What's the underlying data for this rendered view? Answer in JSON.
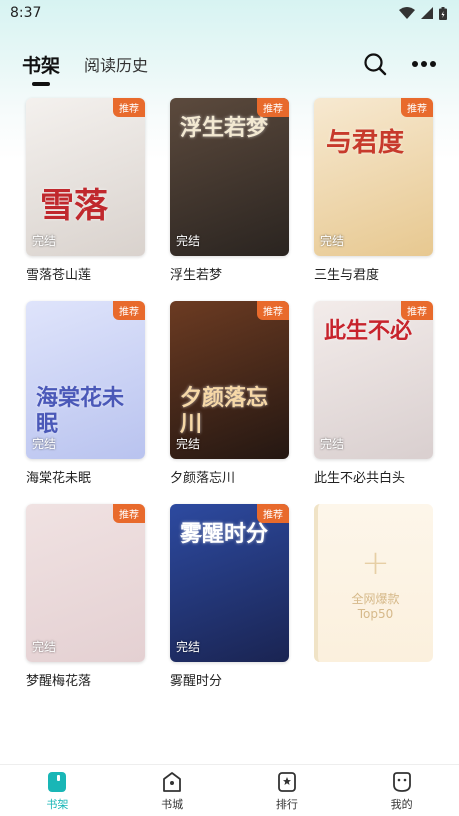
{
  "status_bar": {
    "time": "8:37"
  },
  "header": {
    "tabs": [
      {
        "label": "书架"
      },
      {
        "label": "阅读历史"
      }
    ]
  },
  "books": [
    {
      "title": "雪落苍山莲",
      "badge": "推荐",
      "status": "完结",
      "cover_text": "雪落",
      "cover_colors": [
        "#f4f1ee",
        "#d9d2cd"
      ],
      "accent": "#c0282d"
    },
    {
      "title": "浮生若梦",
      "badge": "推荐",
      "status": "完结",
      "cover_text": "浮生若梦",
      "cover_colors": [
        "#5c4a3d",
        "#2a2420"
      ],
      "accent": "#f3e9d2"
    },
    {
      "title": "三生与君度",
      "badge": "推荐",
      "status": "完结",
      "cover_text": "与君度",
      "cover_colors": [
        "#f7e9d1",
        "#e7c890"
      ],
      "accent": "#c73a2c"
    },
    {
      "title": "海棠花未眠",
      "badge": "推荐",
      "status": "完结",
      "cover_text": "海棠花未眠",
      "cover_colors": [
        "#dfe4fb",
        "#b9c3ef"
      ],
      "accent": "#4a58b8"
    },
    {
      "title": "夕颜落忘川",
      "badge": "推荐",
      "status": "完结",
      "cover_text": "夕颜落忘川",
      "cover_colors": [
        "#6c3b22",
        "#241712"
      ],
      "accent": "#f6d8a7"
    },
    {
      "title": "此生不必共白头",
      "badge": "推荐",
      "status": "完结",
      "cover_text": "此生不必",
      "cover_colors": [
        "#f3ecea",
        "#d9cfcf"
      ],
      "accent": "#c7232c"
    },
    {
      "title": "梦醒梅花落",
      "badge": "推荐",
      "status": "完结",
      "cover_text": "",
      "cover_colors": [
        "#f0e2e2",
        "#e4d0d2"
      ],
      "accent": "#c8a0a4"
    },
    {
      "title": "雾醒时分",
      "badge": "推荐",
      "status": "完结",
      "cover_text": "雾醒时分",
      "cover_colors": [
        "#2d4aa0",
        "#1a2452"
      ],
      "accent": "#ffffff"
    }
  ],
  "placeholder": {
    "line1": "全网爆款",
    "line2": "Top50"
  },
  "bottom_nav": [
    {
      "label": "书架",
      "icon": "bookshelf-icon"
    },
    {
      "label": "书城",
      "icon": "store-icon"
    },
    {
      "label": "排行",
      "icon": "ranking-icon"
    },
    {
      "label": "我的",
      "icon": "profile-icon"
    }
  ],
  "colors": {
    "accent": "#19b6b6",
    "badge": "#e86a2c"
  }
}
